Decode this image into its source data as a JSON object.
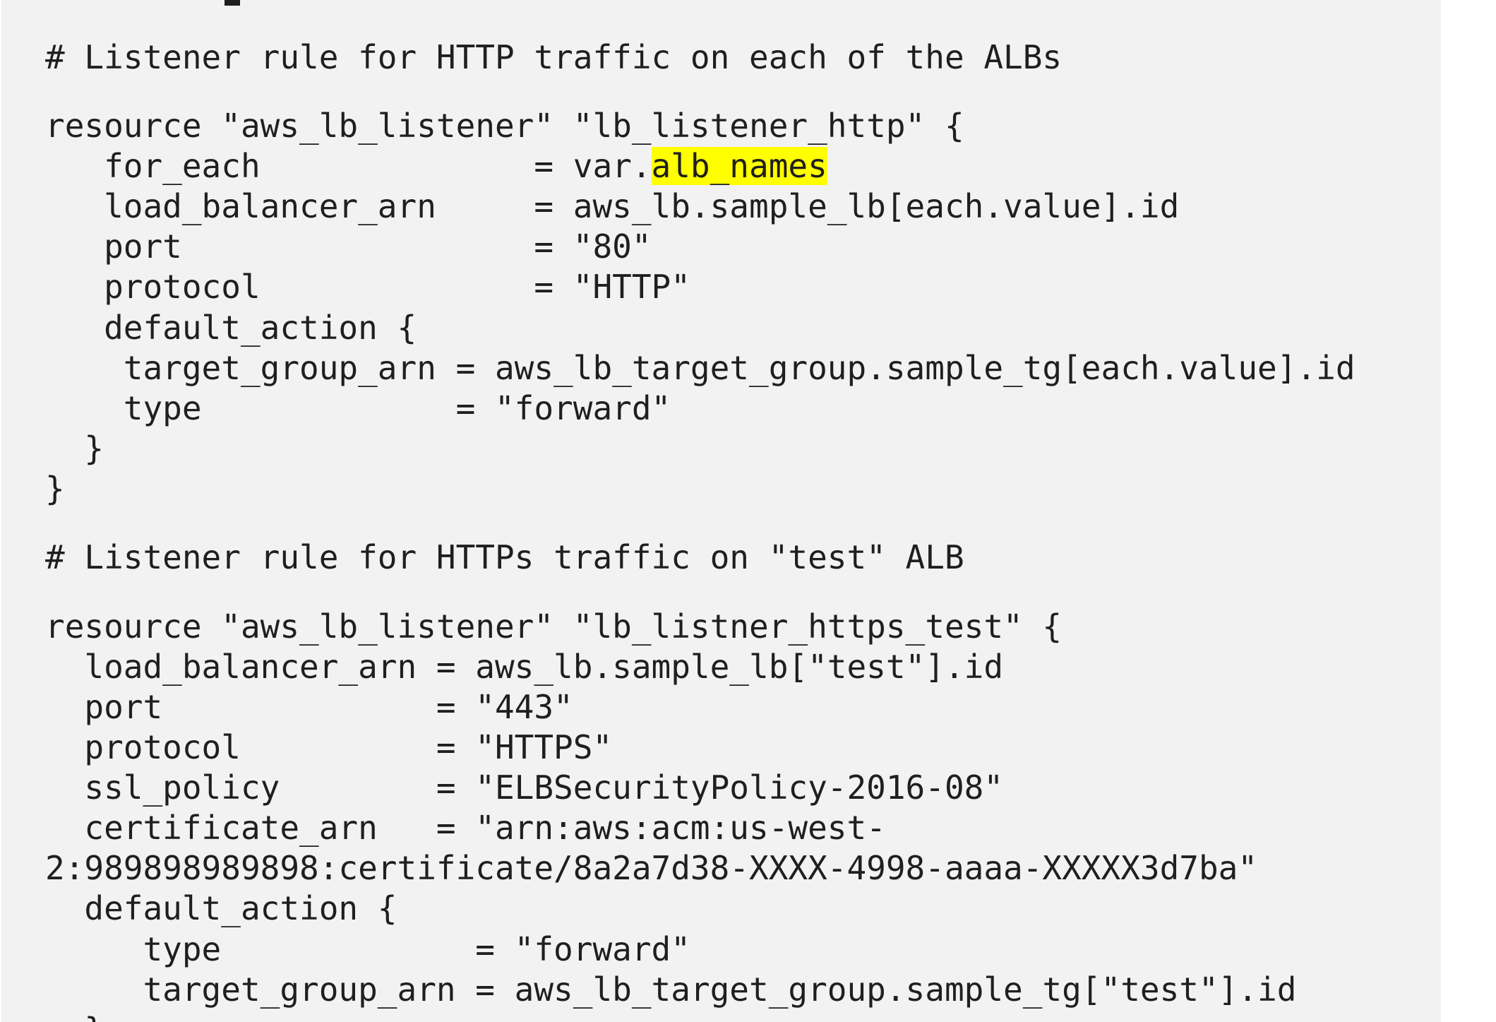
{
  "code": {
    "comment_http": "# Listener rule for HTTP traffic on each of the ALBs",
    "res_http": "resource \"aws_lb_listener\" \"lb_listener_http\" {",
    "foreach_prefix": "   for_each              = var.",
    "foreach_highlight": "alb_names",
    "lb_arn_http": "   load_balancer_arn     = aws_lb.sample_lb[each.value].id",
    "port_http": "   port                  = \"80\"",
    "protocol_http": "   protocol              = \"HTTP\"",
    "default_action_http": "   default_action {",
    "tg_arn_http": "    target_group_arn = aws_lb_target_group.sample_tg[each.value].id",
    "type_http": "    type             = \"forward\"",
    "close_inner_http": "  }",
    "close_outer_http": "}",
    "comment_https": "# Listener rule for HTTPs traffic on \"test\" ALB",
    "res_https": "resource \"aws_lb_listener\" \"lb_listner_https_test\" {",
    "lb_arn_https": "  load_balancer_arn = aws_lb.sample_lb[\"test\"].id",
    "port_https": "  port              = \"443\"",
    "protocol_https": "  protocol          = \"HTTPS\"",
    "ssl_policy": "  ssl_policy        = \"ELBSecurityPolicy-2016-08\"",
    "cert_arn_1": "  certificate_arn   = \"arn:aws:acm:us-west-",
    "cert_arn_2": "2:989898989898:certificate/8a2a7d38-XXXX-4998-aaaa-XXXXX3d7ba\"",
    "default_action_https": "  default_action {",
    "type_https": "     type             = \"forward\"",
    "tg_arn_https": "     target_group_arn = aws_lb_target_group.sample_tg[\"test\"].id",
    "close_partial": "  }"
  },
  "colors": {
    "background": "#f2f2f2",
    "text": "#1f1f1f",
    "highlight": "#ffff00"
  }
}
